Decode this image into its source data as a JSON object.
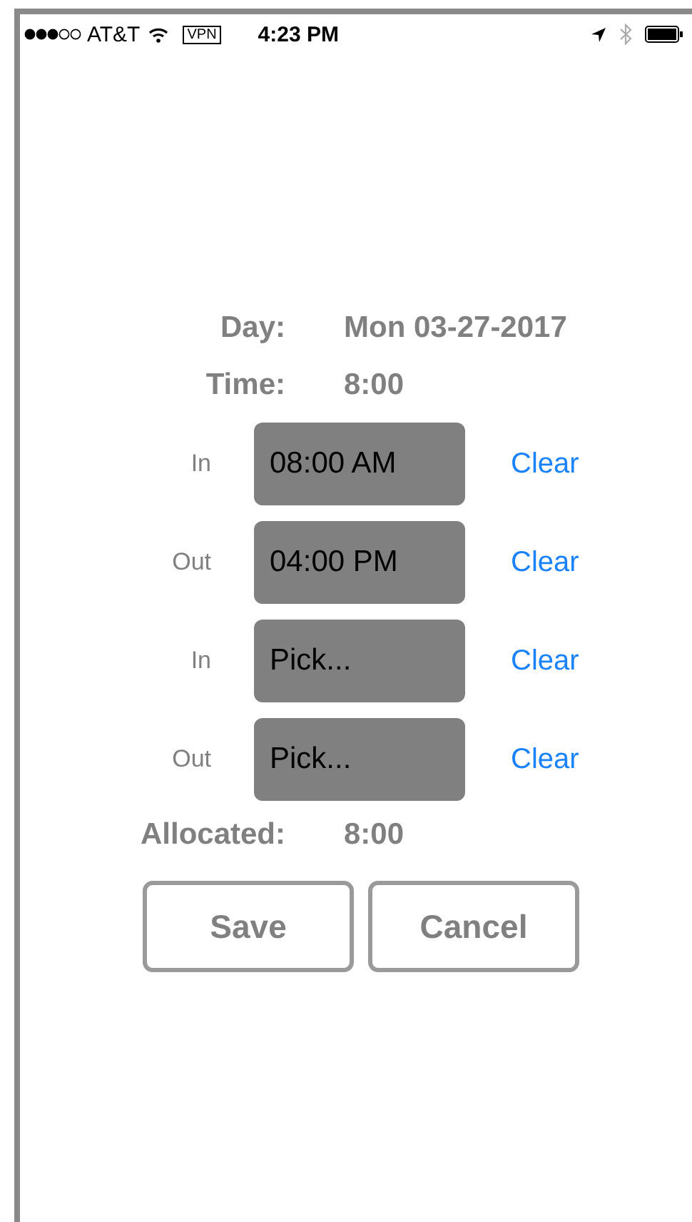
{
  "status_bar": {
    "carrier": "AT&T",
    "vpn": "VPN",
    "time": "4:23 PM"
  },
  "summary": [
    {
      "label": "Day:",
      "value": "Mon 03-27-2017"
    },
    {
      "label": "Time:",
      "value": "8:00"
    }
  ],
  "punches": [
    {
      "label": "In",
      "value": "08:00 AM",
      "action": "Clear"
    },
    {
      "label": "Out",
      "value": "04:00 PM",
      "action": "Clear"
    },
    {
      "label": "In",
      "value": "Pick...",
      "action": "Clear"
    },
    {
      "label": "Out",
      "value": "Pick...",
      "action": "Clear"
    }
  ],
  "allocated": {
    "label": "Allocated:",
    "value": "8:00"
  },
  "buttons": [
    "Save",
    "Cancel"
  ]
}
